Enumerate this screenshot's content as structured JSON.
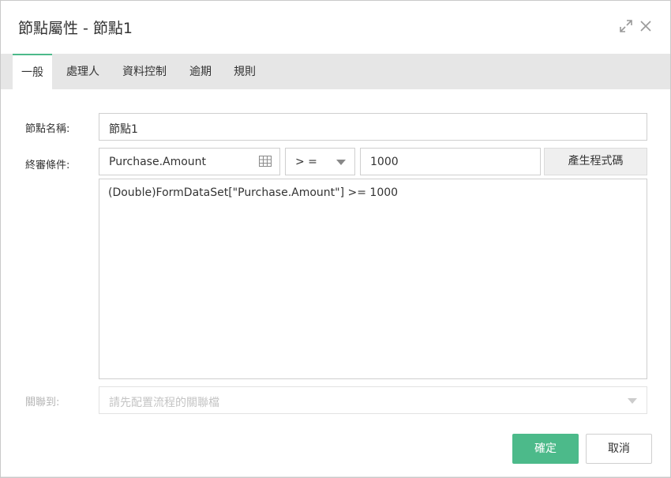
{
  "dialog": {
    "title": "節點屬性 - 節點1",
    "expand_icon": "expand-icon",
    "close_icon": "close-icon"
  },
  "tabs": [
    {
      "label": "一般",
      "active": true
    },
    {
      "label": "處理人",
      "active": false
    },
    {
      "label": "資料控制",
      "active": false
    },
    {
      "label": "逾期",
      "active": false
    },
    {
      "label": "規則",
      "active": false
    }
  ],
  "form": {
    "node_name_label": "節點名稱:",
    "node_name_value": "節點1",
    "condition_label": "終審條件:",
    "condition_field": "Purchase.Amount",
    "field_picker_icon": "table-grid-icon",
    "operator": "> =",
    "operator_dropdown_icon": "caret-down-icon",
    "compare_value": "1000",
    "generate_code_button": "產生程式碼",
    "code_text": "(Double)FormDataSet[\"Purchase.Amount\"] >= 1000",
    "link_label": "關聯到:",
    "link_placeholder": "請先配置流程的關聯檔"
  },
  "footer": {
    "ok_label": "確定",
    "cancel_label": "取消"
  },
  "colors": {
    "accent": "#4cba8a",
    "tabbar_bg": "#e6e6e6"
  }
}
